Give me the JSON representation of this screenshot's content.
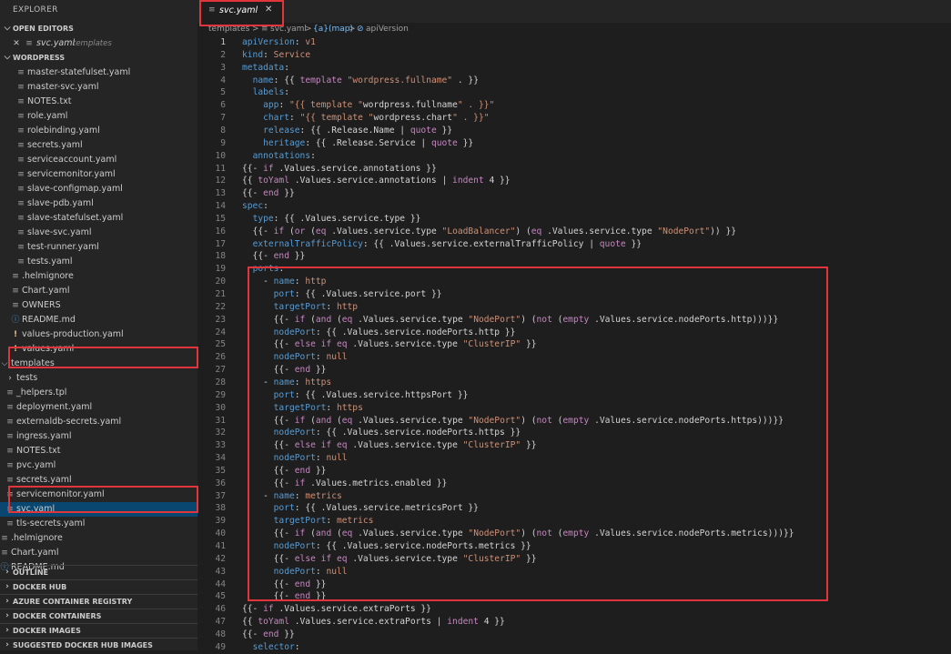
{
  "sidebar": {
    "title": "EXPLORER",
    "sections": {
      "open_editors": "OPEN EDITORS",
      "wordpress": "WORDPRESS",
      "outline": "OUTLINE",
      "docker_hub": "DOCKER HUB",
      "azure": "AZURE CONTAINER REGISTRY",
      "containers": "DOCKER CONTAINERS",
      "images": "DOCKER IMAGES",
      "suggested": "SUGGESTED DOCKER HUB IMAGES"
    },
    "open_editor": {
      "close": "✕",
      "name": "svc.yaml",
      "folder": "templates"
    },
    "tree": [
      {
        "name": "master-statefulset.yaml",
        "icon": "file-icon"
      },
      {
        "name": "master-svc.yaml",
        "icon": "file-icon"
      },
      {
        "name": "NOTES.txt",
        "icon": "file-icon"
      },
      {
        "name": "role.yaml",
        "icon": "file-icon"
      },
      {
        "name": "rolebinding.yaml",
        "icon": "file-icon"
      },
      {
        "name": "secrets.yaml",
        "icon": "file-icon"
      },
      {
        "name": "serviceaccount.yaml",
        "icon": "file-icon"
      },
      {
        "name": "servicemonitor.yaml",
        "icon": "file-icon"
      },
      {
        "name": "slave-configmap.yaml",
        "icon": "file-icon"
      },
      {
        "name": "slave-pdb.yaml",
        "icon": "file-icon"
      },
      {
        "name": "slave-statefulset.yaml",
        "icon": "file-icon"
      },
      {
        "name": "slave-svc.yaml",
        "icon": "file-icon"
      },
      {
        "name": "test-runner.yaml",
        "icon": "file-icon"
      },
      {
        "name": "tests.yaml",
        "icon": "file-icon"
      },
      {
        "name": ".helmignore",
        "icon": "file-icon"
      },
      {
        "name": "Chart.yaml",
        "icon": "file-icon"
      },
      {
        "name": "OWNERS",
        "icon": "file-icon"
      },
      {
        "name": "README.md",
        "icon": "info-icon"
      },
      {
        "name": "values-production.yaml",
        "icon": "exclamation-icon"
      },
      {
        "name": "values.yaml",
        "icon": "exclamation-icon"
      },
      {
        "name": "templates",
        "icon": "chevron-down-icon"
      },
      {
        "name": "tests",
        "icon": "chevron-right-icon"
      },
      {
        "name": "_helpers.tpl",
        "icon": "file-icon"
      },
      {
        "name": "deployment.yaml",
        "icon": "file-icon"
      },
      {
        "name": "externaldb-secrets.yaml",
        "icon": "file-icon"
      },
      {
        "name": "ingress.yaml",
        "icon": "file-icon"
      },
      {
        "name": "NOTES.txt",
        "icon": "file-icon"
      },
      {
        "name": "pvc.yaml",
        "icon": "file-icon"
      },
      {
        "name": "secrets.yaml",
        "icon": "file-icon"
      },
      {
        "name": "servicemonitor.yaml",
        "icon": "file-icon"
      },
      {
        "name": "svc.yaml",
        "icon": "file-icon"
      },
      {
        "name": "tls-secrets.yaml",
        "icon": "file-icon"
      },
      {
        "name": ".helmignore",
        "icon": "file-icon"
      },
      {
        "name": "Chart.yaml",
        "icon": "file-icon"
      },
      {
        "name": "README.md",
        "icon": "info-icon"
      }
    ]
  },
  "tab": {
    "label": "svc.yaml",
    "close": "✕"
  },
  "breadcrumb": {
    "a": "templates",
    "sep": ">",
    "b": "svc.yaml",
    "c": "{a}(map)",
    "d": "apiVersion"
  },
  "editor": {
    "current_line": 1,
    "lines": [
      "apiVersion: v1",
      "kind: Service",
      "metadata:",
      "  name: {{ template \"wordpress.fullname\" . }}",
      "  labels:",
      "    app: \"{{ template \"wordpress.fullname\" . }}\"",
      "    chart: \"{{ template \"wordpress.chart\" . }}\"",
      "    release: {{ .Release.Name | quote }}",
      "    heritage: {{ .Release.Service | quote }}",
      "  annotations:",
      "{{- if .Values.service.annotations }}",
      "{{ toYaml .Values.service.annotations | indent 4 }}",
      "{{- end }}",
      "spec:",
      "  type: {{ .Values.service.type }}",
      "  {{- if (or (eq .Values.service.type \"LoadBalancer\") (eq .Values.service.type \"NodePort\")) }}",
      "  externalTrafficPolicy: {{ .Values.service.externalTrafficPolicy | quote }}",
      "  {{- end }}",
      "  ports:",
      "    - name: http",
      "      port: {{ .Values.service.port }}",
      "      targetPort: http",
      "      {{- if (and (eq .Values.service.type \"NodePort\") (not (empty .Values.service.nodePorts.http)))}}",
      "      nodePort: {{ .Values.service.nodePorts.http }}",
      "      {{- else if eq .Values.service.type \"ClusterIP\" }}",
      "      nodePort: null",
      "      {{- end }}",
      "    - name: https",
      "      port: {{ .Values.service.httpsPort }}",
      "      targetPort: https",
      "      {{- if (and (eq .Values.service.type \"NodePort\") (not (empty .Values.service.nodePorts.https)))}}",
      "      nodePort: {{ .Values.service.nodePorts.https }}",
      "      {{- else if eq .Values.service.type \"ClusterIP\" }}",
      "      nodePort: null",
      "      {{- end }}",
      "      {{- if .Values.metrics.enabled }}",
      "    - name: metrics",
      "      port: {{ .Values.service.metricsPort }}",
      "      targetPort: metrics",
      "      {{- if (and (eq .Values.service.type \"NodePort\") (not (empty .Values.service.nodePorts.metrics)))}}",
      "      nodePort: {{ .Values.service.nodePorts.metrics }}",
      "      {{- else if eq .Values.service.type \"ClusterIP\" }}",
      "      nodePort: null",
      "      {{- end }}",
      "      {{- end }}",
      "{{- if .Values.service.extraPorts }}",
      "{{ toYaml .Values.service.extraPorts | indent 4 }}",
      "{{- end }}",
      "  selector:"
    ]
  },
  "colors": {
    "background": "#1e1e1e",
    "sidebar": "#252526",
    "selection": "#094771",
    "highlight_box": "#e0353b",
    "keyword": "#569cd6",
    "string": "#ce9178",
    "function": "#c586c0"
  }
}
